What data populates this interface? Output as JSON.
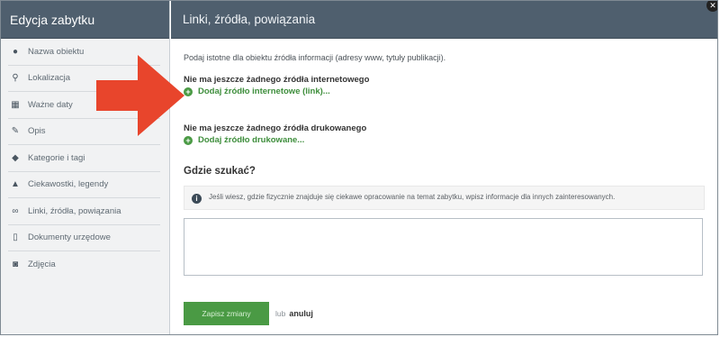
{
  "sidebar": {
    "title": "Edycja zabytku",
    "items": [
      {
        "label": "Nazwa obiektu",
        "icon": "info-circle-icon",
        "glyph": "●"
      },
      {
        "label": "Lokalizacja",
        "icon": "map-marker-icon",
        "glyph": "⚲"
      },
      {
        "label": "Ważne daty",
        "icon": "calendar-icon",
        "glyph": "▦"
      },
      {
        "label": "Opis",
        "icon": "edit-icon",
        "glyph": "✎"
      },
      {
        "label": "Kategorie i tagi",
        "icon": "tag-icon",
        "glyph": "◆"
      },
      {
        "label": "Ciekawostki, legendy",
        "icon": "chart-icon",
        "glyph": "▲"
      },
      {
        "label": "Linki, źródła, powiązania",
        "icon": "link-icon",
        "glyph": "∞"
      },
      {
        "label": "Dokumenty urzędowe",
        "icon": "document-icon",
        "glyph": "▯"
      },
      {
        "label": "Zdjęcia",
        "icon": "camera-icon",
        "glyph": "◙"
      }
    ]
  },
  "main": {
    "title": "Linki, źródła, powiązania",
    "intro": "Podaj istotne dla obiektu źródła informacji (adresy www, tytuły publikacji).",
    "internet": {
      "heading": "Nie ma jeszcze żadnego źródła internetowego",
      "add_label": "Dodaj źródło internetowe (link)..."
    },
    "print": {
      "heading": "Nie ma jeszcze żadnego źródła drukowanego",
      "add_label": "Dodaj źródło drukowane..."
    },
    "where": {
      "heading": "Gdzie szukać?",
      "info": "Jeśli wiesz, gdzie fizycznie znajduje się ciekawe opracowanie na temat zabytku, wpisz informacje dla innych zainteresowanych."
    },
    "actions": {
      "save_label": "Zapisz zmiany",
      "or_label": "lub",
      "cancel_label": "anuluj"
    }
  },
  "colors": {
    "header_bg": "#4f5f6e",
    "accent_green": "#4a9a44",
    "arrow": "#e8452c"
  }
}
